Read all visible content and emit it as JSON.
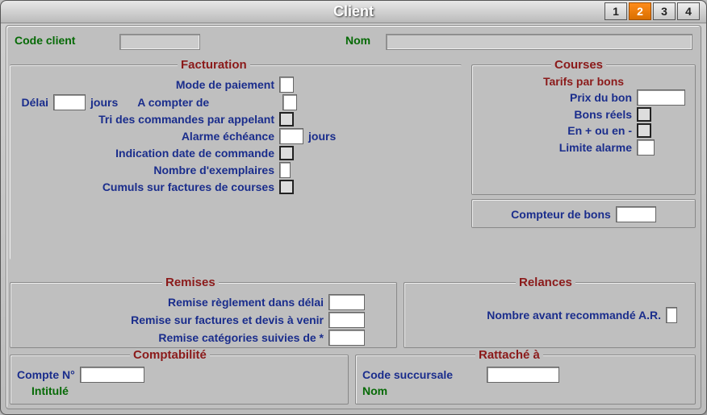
{
  "window": {
    "title": "Client"
  },
  "tabs": {
    "t1": "1",
    "t2": "2",
    "t3": "3",
    "t4": "4",
    "active": 2
  },
  "header": {
    "code_client_label": "Code client",
    "code_client_value": "",
    "nom_label": "Nom",
    "nom_value": ""
  },
  "facturation": {
    "legend": "Facturation",
    "mode_paiement": "Mode de paiement",
    "delai": "Délai",
    "jours": "jours",
    "a_compter_de": "A compter de",
    "tri_appelant": "Tri des commandes par appelant",
    "alarme_echeance": "Alarme échéance",
    "jours2": "jours",
    "indication_date": "Indication date de commande",
    "nb_exemplaires": "Nombre d'exemplaires",
    "cumuls": "Cumuls sur factures de courses",
    "v_mode": "",
    "v_delai": "",
    "v_compter": "",
    "v_alarme": "",
    "v_nbex": ""
  },
  "courses": {
    "legend": "Courses",
    "tarifs": "Tarifs par bons",
    "prix_bon": "Prix du bon",
    "bons_reels": "Bons réels",
    "en_plus_moins": "En + ou en -",
    "limite_alarme": "Limite alarme",
    "compteur_bons": "Compteur de bons",
    "v_prix": "",
    "v_limite": "",
    "v_compteur": ""
  },
  "remises": {
    "legend": "Remises",
    "reglement": "Remise règlement dans délai",
    "factures": "Remise sur factures et devis à venir",
    "categories": "Remise catégories suivies de *",
    "v1": "",
    "v2": "",
    "v3": ""
  },
  "relances": {
    "legend": "Relances",
    "nb_avant_ar": "Nombre avant recommandé A.R.",
    "v_nb": ""
  },
  "comptabilite": {
    "legend": "Comptabilité",
    "compte_no": "Compte N°",
    "intitule": "Intitulé",
    "v_compte": ""
  },
  "rattache": {
    "legend": "Rattaché à",
    "code_succ": "Code succursale",
    "nom": "Nom",
    "v_code": ""
  }
}
